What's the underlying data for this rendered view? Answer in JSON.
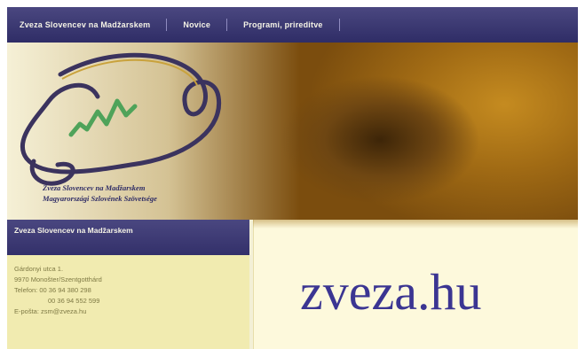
{
  "nav": {
    "items": [
      {
        "label": "Zveza Slovencev na Madžarskem"
      },
      {
        "label": "Novice"
      },
      {
        "label": "Programi, prireditve"
      }
    ]
  },
  "banner": {
    "org_line1": "Zveza Slovencev na Madžarskem",
    "org_line2": "Magyarországi Szlovének Szövetsége"
  },
  "sidebar": {
    "title": "Zveza Slovencev na Madžarskem",
    "address": "Gárdonyi utca 1.",
    "city": "9970 Monošter/Szentgotthárd",
    "phone1": "Telefon: 00 36 94 380 298",
    "phone2": "00 36 94 552 599",
    "email": "E-pošta: zsm@zveza.hu"
  },
  "domain": "zveza.hu",
  "colors": {
    "nav_bg": "#2f2d66",
    "domain_text": "#3b3592",
    "panel_bg": "#fdf9dc"
  }
}
